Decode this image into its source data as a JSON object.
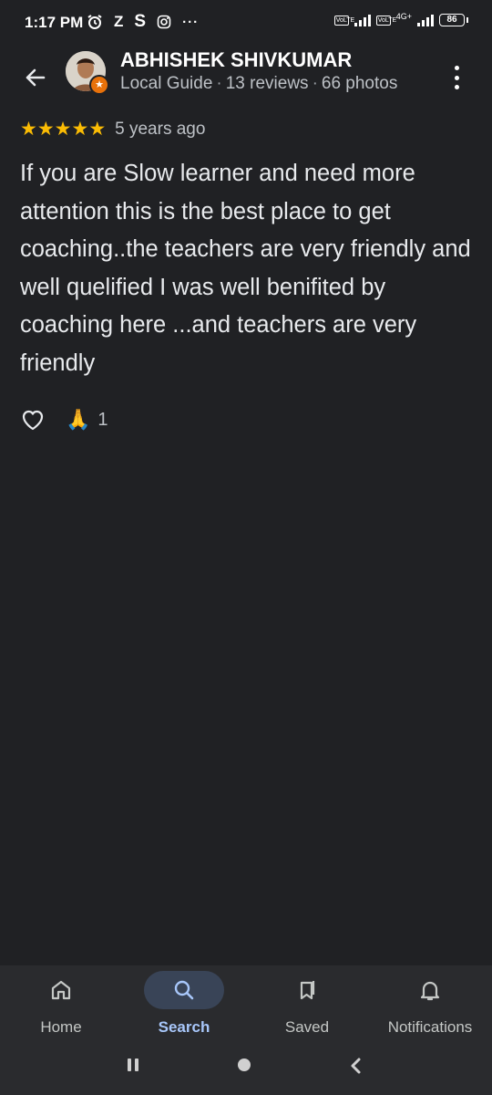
{
  "status_bar": {
    "time": "1:17 PM",
    "icons": [
      "alarm-icon",
      "z-icon",
      "s-icon",
      "instagram-icon",
      "more-notifications-icon"
    ],
    "network_1": "VoLTE",
    "network_2": "VoLTE",
    "network_type": "4G+",
    "battery": "86"
  },
  "header": {
    "reviewer_name": "ABHISHEK SHIVKUMAR",
    "guide_label": "Local Guide",
    "reviews_count": "13 reviews",
    "photos_count": "66 photos",
    "separator": "·"
  },
  "review": {
    "stars": 5,
    "age": "5 years ago",
    "text": "If you are Slow learner and need more attention this is the best place to get coaching..the teachers are very friendly and well quelified I was well benifited by coaching here ...and teachers are very friendly",
    "reaction_emoji": "🙏",
    "reaction_count": "1"
  },
  "bottom_nav": {
    "items": [
      {
        "label": "Home",
        "icon": "home-icon",
        "active": false
      },
      {
        "label": "Search",
        "icon": "search-icon",
        "active": true
      },
      {
        "label": "Saved",
        "icon": "bookmark-icon",
        "active": false
      },
      {
        "label": "Notifications",
        "icon": "bell-icon",
        "active": false
      }
    ]
  },
  "colors": {
    "background": "#202124",
    "star": "#fbbc04",
    "active_nav": "#a8c7fa",
    "active_pill": "#394457",
    "local_guide_badge": "#e8710a"
  }
}
